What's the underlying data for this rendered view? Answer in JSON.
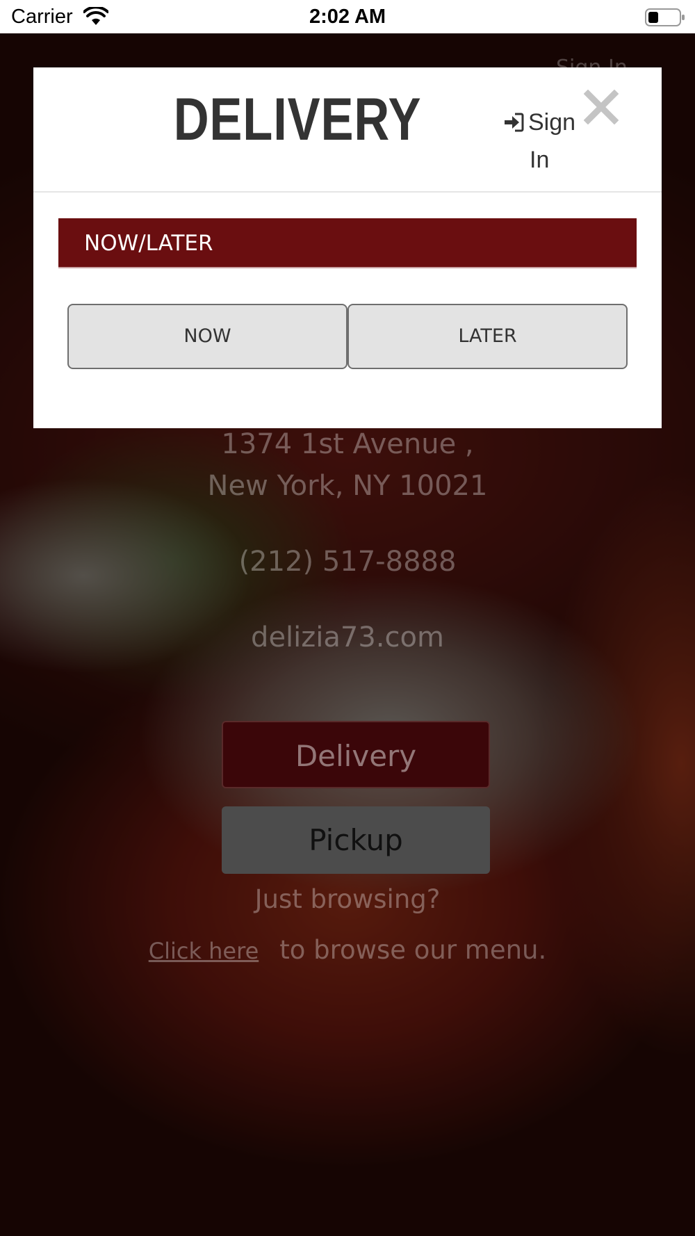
{
  "status_bar": {
    "carrier": "Carrier",
    "time": "2:02 AM"
  },
  "background_page": {
    "sign_in": "Sign In",
    "address_line1": "1374 1st Avenue ,",
    "address_line2": "New York, NY 10021",
    "phone": "(212) 517-8888",
    "website": "delizia73.com",
    "delivery_button": "Delivery",
    "pickup_button": "Pickup",
    "just_browsing": "Just browsing?",
    "click_here": "Click here",
    "browse_text": "to browse our menu."
  },
  "modal": {
    "title": "DELIVERY",
    "sign_in_line1": "Sign",
    "sign_in_line2": "In",
    "section_label": "NOW/LATER",
    "now_button": "NOW",
    "later_button": "LATER"
  },
  "colors": {
    "section_bar": "#6a0e10",
    "choice_button_bg": "#e3e3e3",
    "title_text": "#333333"
  },
  "icons": {
    "wifi": "wifi-icon",
    "battery": "battery-icon",
    "sign_in": "sign-in-icon",
    "close": "close-icon"
  }
}
